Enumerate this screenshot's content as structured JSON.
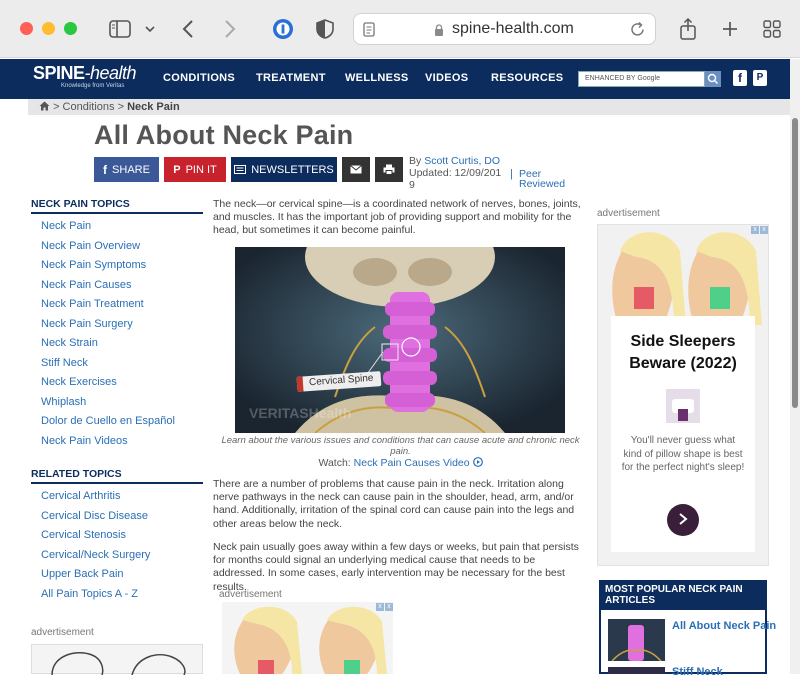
{
  "browser": {
    "url": "spine-health.com",
    "colors": {
      "close": "#ff5f57",
      "minimize": "#febc2e",
      "zoom": "#28c840"
    }
  },
  "site": {
    "logo_main": "SPINE",
    "logo_suffix": "-health",
    "logo_tagline": "Knowledge from Veritas",
    "nav": [
      "CONDITIONS",
      "TREATMENT",
      "WELLNESS",
      "VIDEOS",
      "RESOURCES"
    ],
    "search_placeholder": "ENHANCED BY Google",
    "brand_color": "#0d2c5e",
    "link_color": "#2a6fb5"
  },
  "breadcrumb": {
    "home_icon": "home-icon",
    "items": [
      "Conditions",
      "Neck Pain"
    ]
  },
  "article": {
    "title": "All About Neck Pain",
    "share_buttons": [
      {
        "label": "SHARE",
        "icon": "facebook-icon",
        "color": "#3b5998"
      },
      {
        "label": "PIN IT",
        "icon": "pinterest-icon",
        "color": "#c8232c"
      },
      {
        "label": "NEWSLETTERS",
        "icon": "newsletter-icon",
        "color": "#0d2c5e"
      },
      {
        "label": "",
        "icon": "email-icon",
        "color": "#333333"
      },
      {
        "label": "",
        "icon": "print-icon",
        "color": "#333333"
      }
    ],
    "by_prefix": "By",
    "author": "Scott Curtis, DO",
    "updated_line1": "Updated: 12/09/201",
    "updated_line2": "9",
    "peer_line1": "Peer",
    "peer_line2": "Reviewed",
    "intro": "The neck—or cervical spine—is a coordinated network of nerves, bones, joints, and muscles. It has the important job of providing support and mobility for the head, but sometimes it can become painful.",
    "video_label": "Cervical Spine",
    "video_watermark": "VERITASHealth",
    "caption": "Learn about the various issues and conditions that can cause acute and chronic neck pain.",
    "watch_prefix": "Watch:",
    "watch_link": "Neck Pain Causes Video",
    "para2": "There are a number of problems that cause pain in the neck. Irritation along nerve pathways in the neck can cause pain in the shoulder, head, arm, and/or hand. Additionally, irritation of the spinal cord can cause pain into the legs and other areas below the neck.",
    "para3": "Neck pain usually goes away within a few days or weeks, but pain that persists for months could signal an underlying medical cause that needs to be addressed. In some cases, early intervention may be necessary for the best results."
  },
  "sidebar": {
    "topics_heading": "NECK PAIN TOPICS",
    "topics": [
      "Neck Pain",
      "Neck Pain Overview",
      "Neck Pain Symptoms",
      "Neck Pain Causes",
      "Neck Pain Treatment",
      "Neck Pain Surgery",
      "Neck Strain",
      "Stiff Neck",
      "Neck Exercises",
      "Whiplash",
      "Dolor de Cuello en Español",
      "Neck Pain Videos"
    ],
    "related_heading": "RELATED TOPICS",
    "related": [
      "Cervical Arthritis",
      "Cervical Disc Disease",
      "Cervical Stenosis",
      "Cervical/Neck Surgery",
      "Upper Back Pain",
      "All Pain Topics A - Z"
    ],
    "ad_label": "advertisement"
  },
  "right_ad": {
    "label": "advertisement",
    "title": "Side Sleepers Beware (2022)",
    "text": "You'll never guess what kind of pillow shape is best for the perfect night's sleep!"
  },
  "popular": {
    "heading": "MOST POPULAR NECK PAIN ARTICLES",
    "items": [
      "All About Neck Pain",
      "Stiff Neck"
    ]
  },
  "mid_ad_label": "advertisement"
}
